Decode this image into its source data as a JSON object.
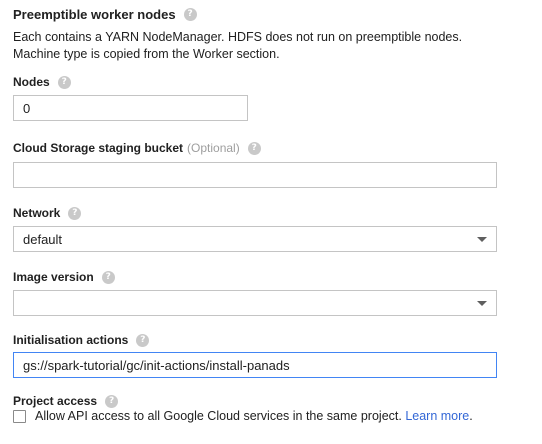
{
  "preemptible": {
    "title": "Preemptible worker nodes",
    "description_line1": "Each contains a YARN NodeManager. HDFS does not run on preemptible nodes.",
    "description_line2": "Machine type is copied from the Worker section."
  },
  "nodes": {
    "label": "Nodes",
    "value": "0"
  },
  "staging_bucket": {
    "label": "Cloud Storage staging bucket",
    "optional": "(Optional)",
    "value": ""
  },
  "network": {
    "label": "Network",
    "value": "default"
  },
  "image_version": {
    "label": "Image version",
    "value": ""
  },
  "init_actions": {
    "label": "Initialisation actions",
    "value": "gs://spark-tutorial/gc/init-actions/install-panads"
  },
  "project_access": {
    "label": "Project access",
    "checkbox_text": "Allow API access to all Google Cloud services in the same project.",
    "learn_more": "Learn more",
    "trailing": "."
  },
  "help_glyph": "?",
  "icons": {
    "help": "help-icon",
    "dropdown": "chevron-down-icon"
  },
  "colors": {
    "focus": "#4285f4",
    "link": "#3367d6"
  }
}
